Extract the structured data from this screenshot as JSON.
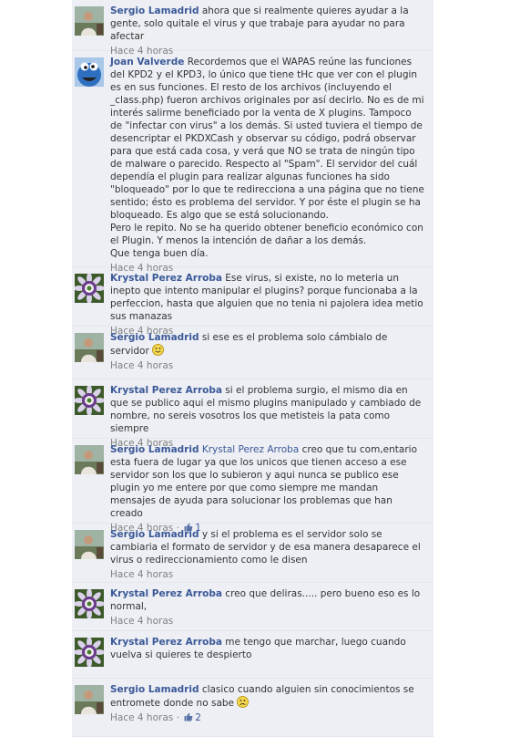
{
  "comments": [
    {
      "author": "Sergio Lamadrid",
      "avatar": "person-photo",
      "mention": "",
      "body": "ahora que si realmente quieres ayudar a la gente, solo quitale el virus y que trabaje para ayudar no para afectar",
      "emoji": "",
      "time": "Hace 4 horas",
      "likes": ""
    },
    {
      "author": "Joan Valverde",
      "avatar": "cookie-monster-photo",
      "mention": "",
      "body": "Recordemos que el WAPAS reúne las funciones del KPD2 y el KPD3, lo único que tiene tHc que ver con el plugin es en sus funciones. El resto de los archivos (incluyendo el _class.php) fueron archivos originales por así decirlo. No es de mi interés salirme beneficiado por la venta de X plugins. Tampoco de \"infectar con virus\" a los demás. Si usted tuviera el tiempo de desencriptar el PKDXCash y observar su código, podrá observar para que está cada cosa, y verá que NO se trata de ningún tipo de malware o parecido. Respecto al \"Spam\". El servidor del cuál dependía el plugin para realizar algunas funciones ha sido \"bloqueado\" por lo que te redirecciona a una página que no tiene sentido; ésto es problema del servidor. Y por éste el plugin se ha bloqueado. Es algo que se está solucionando.\nPero le repito. No se ha querido obtener beneficio económico con el Plugin. Y menos la intención de dañar a los demás.\nQue tenga buen día.",
      "emoji": "",
      "time": "Hace 4 horas",
      "likes": ""
    },
    {
      "author": "Krystal Perez Arroba",
      "avatar": "passion-flower-photo",
      "mention": "",
      "body": "Ese virus, si existe, no lo meteria un inepto que intento manipular el plugins? porque funcionaba a la perfeccion, hasta que alguien que no tenia ni pajolera idea metio sus manazas",
      "emoji": "",
      "time": "Hace 4 horas",
      "likes": ""
    },
    {
      "author": "Sergio Lamadrid",
      "avatar": "person-photo",
      "mention": "",
      "body": "si ese es el problema solo cámbialo de servidor",
      "emoji": "smile-emoticon",
      "time": "Hace 4 horas",
      "likes": ""
    },
    {
      "author": "Krystal Perez Arroba",
      "avatar": "passion-flower-photo",
      "mention": "",
      "body": "si el problema surgio, el mismo dia en que se publico aqui el mismo plugins manipulado y cambiado de nombre, no sereis vosotros los que metisteis la pata como siempre",
      "emoji": "",
      "time": "Hace 4 horas",
      "likes": ""
    },
    {
      "author": "Sergio Lamadrid",
      "avatar": "person-photo",
      "mention": "Krystal Perez Arroba",
      "body": "creo que tu com,entario esta fuera de lugar ya que los unicos que tienen acceso a ese servidor son los que lo subieron y aqui nunca se publico ese plugin yo me entere por que como siempre me mandan mensajes de ayuda para solucionar los problemas que han creado",
      "emoji": "",
      "time": "Hace 4 horas",
      "likes": "1"
    },
    {
      "author": "Sergio Lamadrid",
      "avatar": "person-photo",
      "mention": "",
      "body": "y si el problema es el servidor solo se cambiaria el formato de servidor y de esa manera desaparece el virus o redireccionamiento como le disen",
      "emoji": "",
      "time": "Hace 4 horas",
      "likes": ""
    },
    {
      "author": "Krystal Perez Arroba",
      "avatar": "passion-flower-photo",
      "mention": "",
      "body": "creo que deliras..... pero bueno eso es lo normal,",
      "emoji": "",
      "time": "Hace 4 horas",
      "likes": ""
    },
    {
      "author": "Krystal Perez Arroba",
      "avatar": "passion-flower-photo",
      "mention": "",
      "body": "me tengo que marchar, luego cuando vuelva si quieres te despierto",
      "emoji": "",
      "time": "",
      "likes": ""
    },
    {
      "author": "Sergio Lamadrid",
      "avatar": "person-photo",
      "mention": "",
      "body": "clasico cuando alguien sin conocimientos se entromete donde no sabe",
      "emoji": "sad-emoticon",
      "time": "Hace 4 horas",
      "likes": "2"
    }
  ],
  "meta_separator": "·",
  "colors": {
    "link": "#3b5998",
    "panel": "#edeff4",
    "timestamp": "#808080"
  }
}
